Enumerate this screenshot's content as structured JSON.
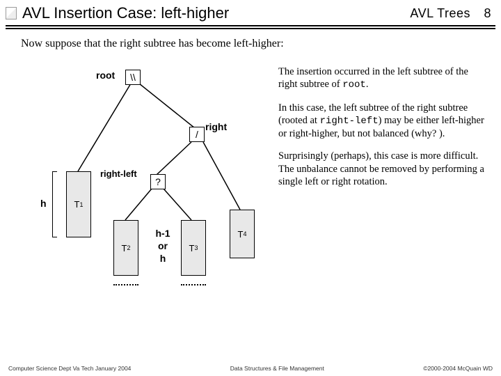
{
  "header": {
    "title": "AVL Insertion Case: left-higher",
    "topic": "AVL Trees",
    "page": "8"
  },
  "intro": "Now suppose that the right subtree has become left-higher:",
  "diagram": {
    "root_label": "root",
    "root_bf": "\\\\",
    "right_label": "right",
    "right_bf": "/",
    "rightleft_label": "right-left",
    "rightleft_bf": "?",
    "h_label": "h",
    "T1": "T",
    "T1s": "1",
    "T2": "T",
    "T2s": "2",
    "T3": "T",
    "T3s": "3",
    "T4": "T",
    "T4s": "4",
    "mid_top": "h-1",
    "mid_mid": "or",
    "mid_bot": "h"
  },
  "paras": {
    "p1a": "The insertion occurred in the left subtree of the right subtree of ",
    "p1code": "root",
    "p1b": ".",
    "p2a": "In this case, the left subtree of the right subtree (rooted at ",
    "p2code": "right-left",
    "p2b": ") may be either left-higher or right-higher, but not balanced (why? ).",
    "p3": "Surprisingly (perhaps), this case is more difficult.  The unbalance cannot be removed by performing a single left or right rotation."
  },
  "footer": {
    "left": "Computer Science Dept Va Tech January 2004",
    "center": "Data Structures & File Management",
    "right": "©2000-2004 McQuain WD"
  }
}
